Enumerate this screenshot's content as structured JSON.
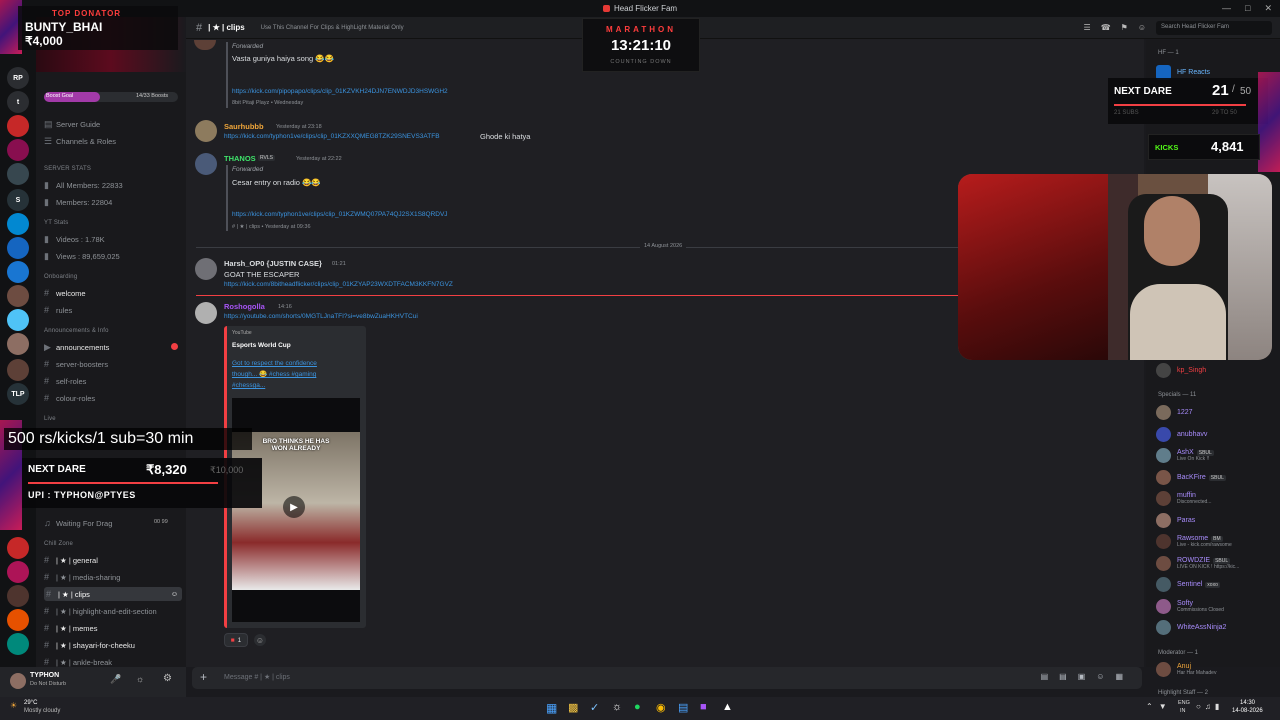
{
  "window": {
    "title": "Head Flicker Fam"
  },
  "donator": {
    "label": "TOP DONATOR",
    "name": "BUNTY_BHAI",
    "amount": "₹4,000"
  },
  "marathon": {
    "label": "MARATHON",
    "time": "13:21:10",
    "sub": "COUNTING DOWN"
  },
  "next_dare_top": {
    "label": "NEXT DARE",
    "current": "21",
    "goal": "50",
    "subs_label": "21 SUBS",
    "subs_range": "29 TO 50"
  },
  "kicks": {
    "label": "KICKS",
    "value": "4,841"
  },
  "promo": {
    "rate": "500 rs/kicks/1 sub=30 min",
    "dare_label": "NEXT DARE",
    "dare_amount": "₹8,320",
    "dare_goal": "₹10,000",
    "upi": "UPI : TYPHON@PTYES"
  },
  "channel_header": {
    "name": "| ★ | clips",
    "topic": "Use This Channel For Clips & HighLight Material Only",
    "search_placeholder": "Search Head Flicker Fam"
  },
  "sidebar": {
    "boost": {
      "label": "Boost Goal",
      "count": "14/33 Boosts"
    },
    "guide": [
      "Server Guide",
      "Channels & Roles"
    ],
    "stats_header": "SERVER STATS",
    "stats": [
      "All Members: 22833",
      "Members: 22804"
    ],
    "yt_header": "YT Stats",
    "yt": [
      "Videos : 1.78K",
      "Views : 89,659,025"
    ],
    "onboarding_header": "Onboarding",
    "onboarding": [
      "welcome",
      "rules"
    ],
    "announce_header": "Announcements & Info",
    "announce": [
      "announcements",
      "server-boosters",
      "self-roles",
      "colour-roles"
    ],
    "live_header": "Live",
    "waiting": "Waiting For Drag",
    "waiting_count": "00 99",
    "chill_header": "Chill Zone",
    "chill": [
      "| ★ | general",
      "| ★ | media-sharing",
      "| ★ | clips",
      "| ★ | highlight-and-edit-section",
      "| ★ | memes",
      "| ★ | shayari-for-cheeku",
      "| ★ | ankle-break"
    ]
  },
  "user": {
    "name": "TYPHON",
    "status": "Do Not Disturb"
  },
  "messages": {
    "m1": {
      "forwarded": "Forwarded",
      "text": "Vasta guniya haiya song 😂😂",
      "link": "https://kick.com/pipopapo/clips/clip_01KZVKH24DJN7ENWDJD3HSWGH2",
      "footer": "8bit Pitaji Playz • Wednesday"
    },
    "m2": {
      "name": "Saurhubbb",
      "time": "Yesterday at 23:18",
      "link": "https://kick.com/typhon1ve/clips/clip_01KZXXQMEG8TZK29SNEVS3ATFB",
      "text": "Ghode ki hatya"
    },
    "m3": {
      "name": "THANOS",
      "badge": "RVLS",
      "time": "Yesterday at 22:22",
      "forwarded": "Forwarded",
      "text": "Cesar entry on radio 😂😂",
      "link": "https://kick.com/typhon1ve/clips/clip_01KZWMQ07PA74QJ2SX1S8QRDVJ",
      "footer": "# | ★ | clips • Yesterday at 09:36"
    },
    "divider": "14 August 2026",
    "m4": {
      "name": "Harsh_OP0 {JUSTIN CASE}",
      "time": "01:21",
      "text": "GOAT THE ESCAPER",
      "link": "https://kick.com/8bitheadflicker/clips/clip_01KZYAP23WXDTFACM3KKFN7GVZ"
    },
    "m5": {
      "name": "Roshogolla",
      "time": "14:16",
      "link": "https://youtube.com/shorts/0MGTLJnaTFI?si=ve8bwZuaHKHVTCui",
      "embed_provider": "YouTube",
      "embed_author": "Esports World Cup",
      "embed_title": "Got to respect the confidence though... 😂 #chess #gaming #chessga...",
      "thumb_caption": "BRO THINKS HE HAS WON ALREADY",
      "reaction_count": "1"
    }
  },
  "composer": {
    "placeholder": "Message # | ★ | clips"
  },
  "members": {
    "hf_header": "HF — 1",
    "hf_reacts": "HF Reacts",
    "kp": "kp_Singh",
    "specials_header": "Specials — 11",
    "list": [
      {
        "name": "1227",
        "sub": "",
        "tag": ""
      },
      {
        "name": "anubhavv",
        "sub": "",
        "tag": ""
      },
      {
        "name": "AshX",
        "sub": "Live On Kick !!",
        "tag": "SBUL"
      },
      {
        "name": "BacKFire",
        "sub": "",
        "tag": "SBUL"
      },
      {
        "name": "muffin",
        "sub": "Disconnected...",
        "tag": ""
      },
      {
        "name": "Paras",
        "sub": "",
        "tag": ""
      },
      {
        "name": "Rawsome",
        "sub": "Live - kick.com/rawsome",
        "tag": "BM"
      },
      {
        "name": "ROWDZIE",
        "sub": "LIVE ON KICK ! https://kic...",
        "tag": "SBUL"
      },
      {
        "name": "Sentinel",
        "sub": "",
        "tag": "xoxo"
      },
      {
        "name": "Softy",
        "sub": "Commissions Closed",
        "tag": ""
      },
      {
        "name": "WhiteAssNinja2",
        "sub": "",
        "tag": ""
      }
    ],
    "moderator_header": "Moderator — 1",
    "anuj": "Anuj",
    "anuj_sub": "Har Har Mahadev",
    "highlight_header": "Highlight Staff — 2"
  },
  "taskbar": {
    "temp": "29°C",
    "weather": "Mostly cloudy",
    "lang1": "ENG",
    "lang2": "IN",
    "time": "14:30",
    "date": "14-08-2026"
  }
}
